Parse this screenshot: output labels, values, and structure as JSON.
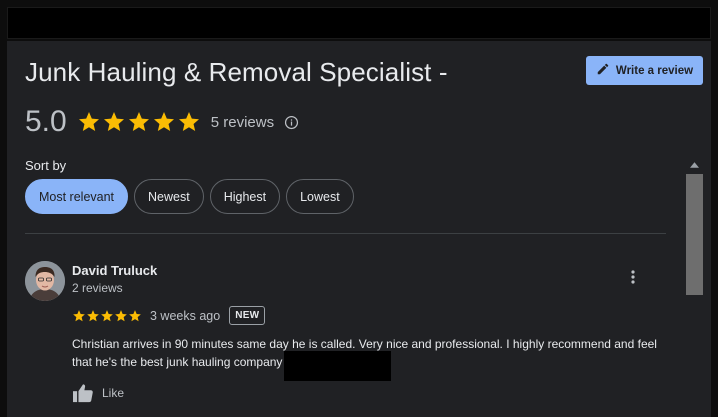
{
  "business": {
    "title": "Junk Hauling & Removal Specialist -",
    "rating": "5.0",
    "review_count": "5 reviews"
  },
  "write_review": {
    "label": "Write a review"
  },
  "sort": {
    "label": "Sort by",
    "options": [
      "Most relevant",
      "Newest",
      "Highest",
      "Lowest"
    ],
    "selected": "Most relevant"
  },
  "review": {
    "author": "David Truluck",
    "author_reviews": "2 reviews",
    "stars": 5,
    "time": "3 weeks ago",
    "badge": "NEW",
    "text": "Christian arrives in 90 minutes same day he is called. Very nice and professional. I highly recommend and feel that he's the best junk hauling company",
    "like_label": "Like"
  },
  "colors": {
    "accent": "#8ab4f8",
    "star": "#fbbc04",
    "panel_bg": "#202124"
  }
}
